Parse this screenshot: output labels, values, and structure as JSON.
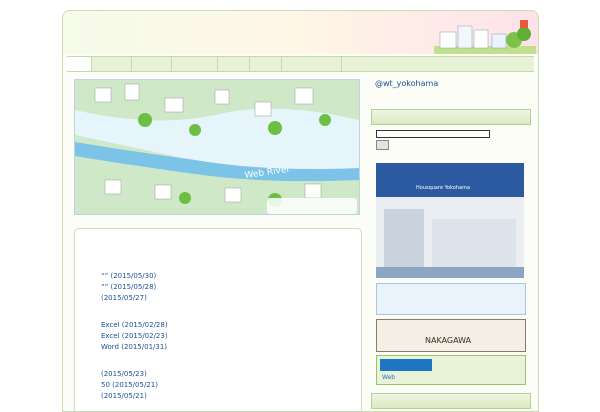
{
  "header": {
    "logo_text": "",
    "tagline": ""
  },
  "nav": {
    "items": [
      {
        "label": ""
      },
      {
        "label": ""
      },
      {
        "label": ""
      },
      {
        "label": ""
      },
      {
        "label": ""
      },
      {
        "label": ""
      },
      {
        "label": ""
      }
    ]
  },
  "hero": {
    "river_label": "Web River",
    "logo_text": ""
  },
  "news": {
    "title": "",
    "groups": [
      {
        "heading": "",
        "links": [
          {
            "text": "“” (2015/05/30)"
          },
          {
            "text": "“” (2015/05/28)"
          },
          {
            "text": "(2015/05/27)"
          }
        ]
      },
      {
        "heading": "",
        "links": [
          {
            "text": "Excel (2015/02/28)"
          },
          {
            "text": "Excel (2015/02/23)"
          },
          {
            "text": "Word (2015/01/31)"
          }
        ]
      },
      {
        "heading": "",
        "links": [
          {
            "text": "(2015/05/23)"
          },
          {
            "text": "50 (2015/05/21)"
          },
          {
            "text": "(2015/05/21)"
          }
        ]
      }
    ]
  },
  "sidebar": {
    "twitter_link": "@wt_yokohama",
    "search_heading": "",
    "search_button": "",
    "bottom_heading": "",
    "banners": {
      "housequare_title": "",
      "housequare_sub": "Housquare Yokohama",
      "center_navi": "",
      "cafe_line1": "",
      "cafe_line2": "NAKAGAWA",
      "ad_title": "",
      "ad_sub": "Web"
    }
  }
}
